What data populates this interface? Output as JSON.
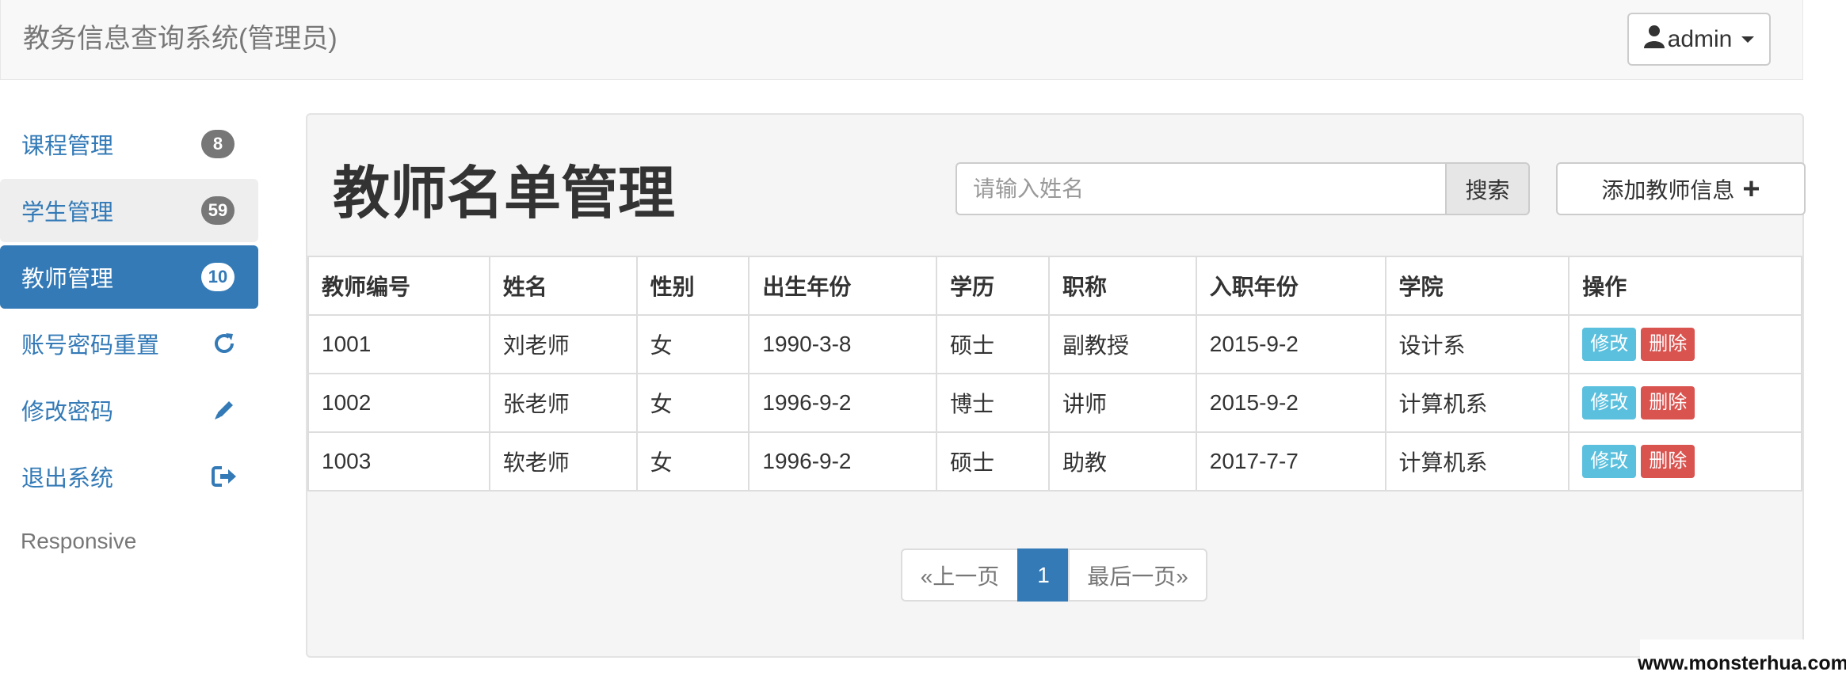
{
  "navbar": {
    "brand": "教务信息查询系统(管理员)",
    "user_label": "admin"
  },
  "sidebar": {
    "items": [
      {
        "label": "课程管理",
        "badge": "8",
        "icon": ""
      },
      {
        "label": "学生管理",
        "badge": "59",
        "icon": ""
      },
      {
        "label": "教师管理",
        "badge": "10",
        "icon": ""
      },
      {
        "label": "账号密码重置",
        "badge": "",
        "icon": "refresh-icon"
      },
      {
        "label": "修改密码",
        "badge": "",
        "icon": "pencil-icon"
      },
      {
        "label": "退出系统",
        "badge": "",
        "icon": "logout-icon"
      }
    ],
    "footer": "Responsive"
  },
  "main": {
    "title": "教师名单管理",
    "search_placeholder": "请输入姓名",
    "search_label": "搜索",
    "add_label": "添加教师信息",
    "table": {
      "headers": [
        "教师编号",
        "姓名",
        "性别",
        "出生年份",
        "学历",
        "职称",
        "入职年份",
        "学院",
        "操作"
      ],
      "rows": [
        [
          "1001",
          "刘老师",
          "女",
          "1990-3-8",
          "硕士",
          "副教授",
          "2015-9-2",
          "设计系"
        ],
        [
          "1002",
          "张老师",
          "女",
          "1996-9-2",
          "博士",
          "讲师",
          "2015-9-2",
          "计算机系"
        ],
        [
          "1003",
          "软老师",
          "女",
          "1996-9-2",
          "硕士",
          "助教",
          "2017-7-7",
          "计算机系"
        ]
      ],
      "edit_label": "修改",
      "delete_label": "删除"
    },
    "pagination": {
      "prev": "«上一页",
      "current": "1",
      "last": "最后一页»"
    }
  },
  "watermark": "www.monsterhua.com",
  "colors": {
    "primary": "#337ab7",
    "info": "#5bc0de",
    "danger": "#d9534f",
    "badge": "#777777"
  }
}
